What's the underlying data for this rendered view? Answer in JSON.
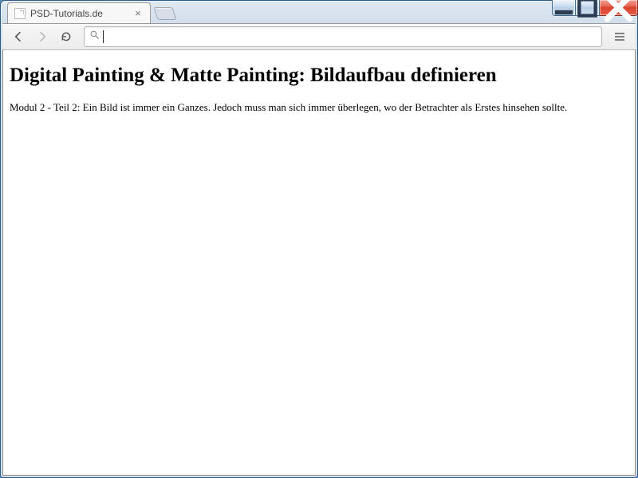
{
  "window": {
    "tab_title": "PSD-Tutorials.de"
  },
  "toolbar": {
    "address_value": ""
  },
  "page": {
    "heading": "Digital Painting & Matte Painting: Bildaufbau definieren",
    "paragraph": "Modul 2 - Teil 2: Ein Bild ist immer ein Ganzes. Jedoch muss man sich immer überlegen, wo der Betrachter als Erstes hinsehen sollte."
  }
}
